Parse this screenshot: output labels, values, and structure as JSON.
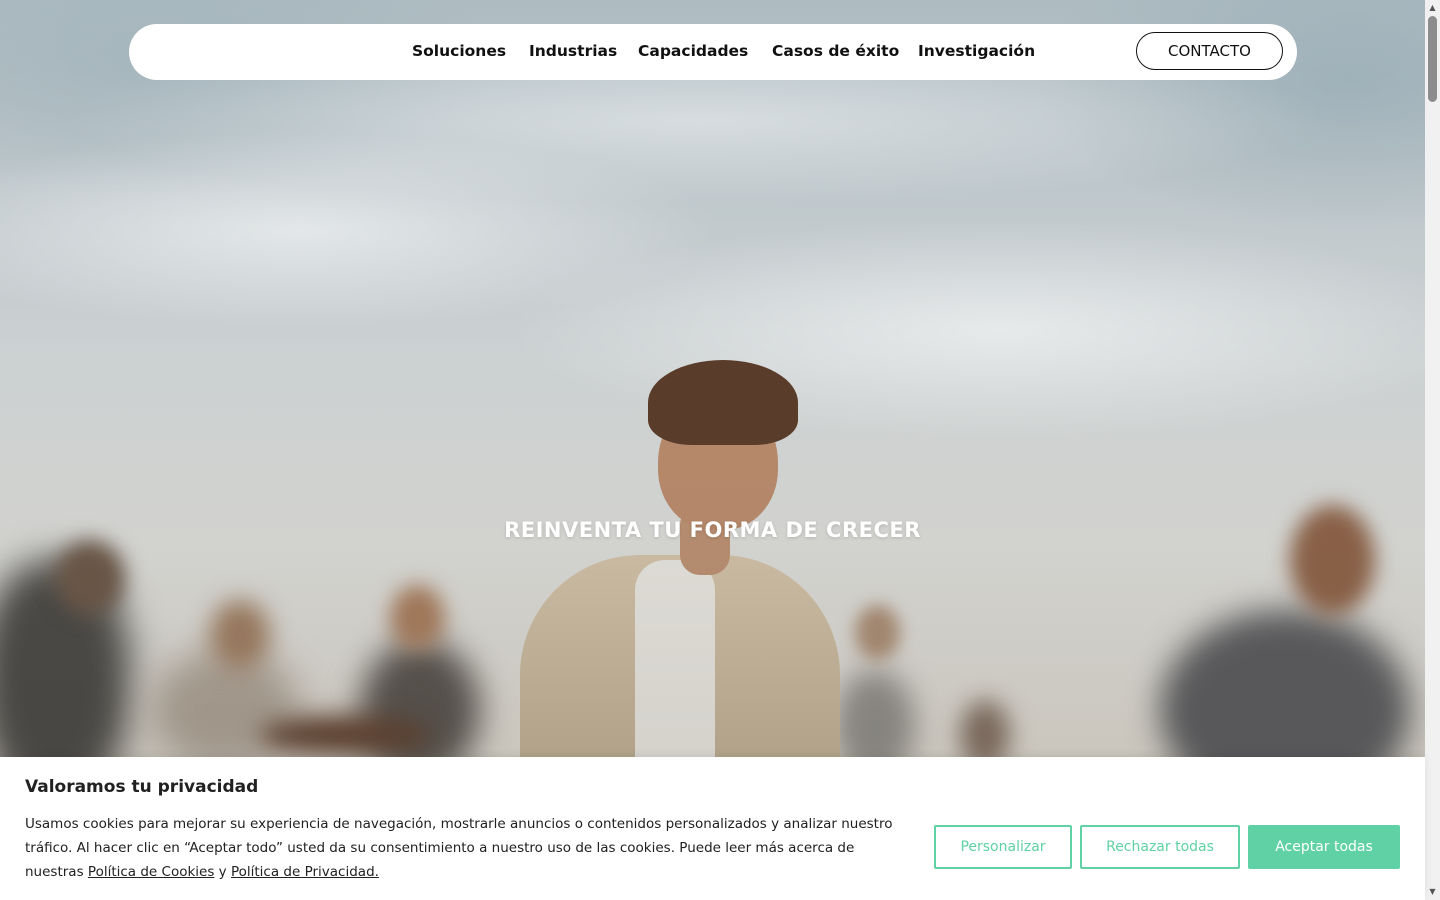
{
  "nav": {
    "links": [
      "Soluciones",
      "Industrias",
      "Capacidades",
      "Casos de éxito",
      "Investigación"
    ],
    "contact_label": "CONTACTO"
  },
  "hero": {
    "title": "REINVENTA TU FORMA DE CRECER"
  },
  "cookie": {
    "title": "Valoramos tu privacidad",
    "text_before": "Usamos cookies para mejorar su experiencia de navegación, mostrarle anuncios o contenidos personalizados y analizar nuestro tráfico. Al hacer clic en “Aceptar todo” usted da su consentimiento a nuestro uso de las cookies. Puede leer más acerca de nuestras ",
    "cookie_policy_link": "Política de Cookies",
    "text_between": " y ",
    "privacy_policy_link": "Política de Privacidad.",
    "buttons": {
      "customize": "Personalizar",
      "reject": "Rechazar todas",
      "accept": "Aceptar todas"
    }
  },
  "colors": {
    "accent": "#5fd1a4",
    "text": "#212121"
  },
  "icons": {
    "scroll_up": "scroll-up-arrow-icon",
    "scroll_down": "scroll-down-arrow-icon"
  }
}
